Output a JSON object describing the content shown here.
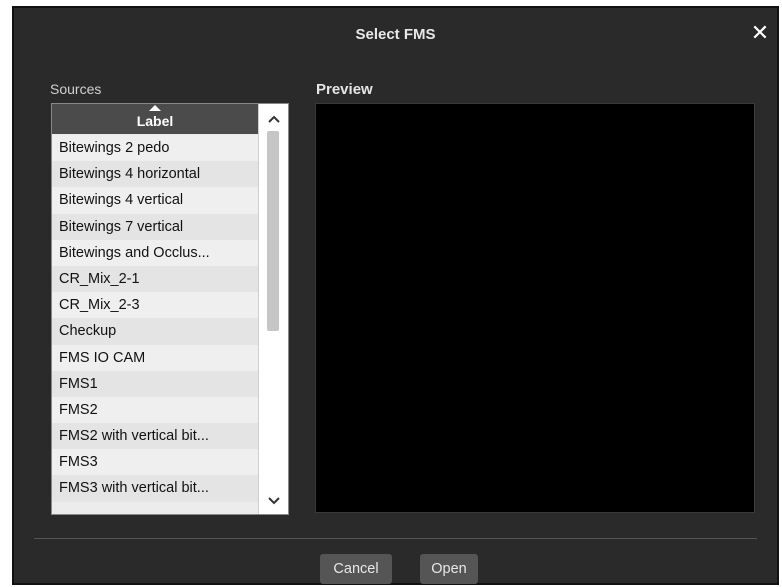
{
  "dialog": {
    "title": "Select FMS",
    "close_glyph": "✕"
  },
  "sources": {
    "label": "Sources",
    "column_header": "Label",
    "items": [
      "Bitewings 2 pedo",
      "Bitewings 4 horizontal",
      "Bitewings 4 vertical",
      "Bitewings 7 vertical",
      "Bitewings and Occlus...",
      "CR_Mix_2-1",
      "CR_Mix_2-3",
      "Checkup",
      "FMS IO CAM",
      "FMS1",
      "FMS2",
      "FMS2 with vertical bit...",
      "FMS3",
      "FMS3 with vertical bit..."
    ]
  },
  "preview": {
    "label": "Preview"
  },
  "buttons": {
    "cancel": "Cancel",
    "open": "Open"
  },
  "icons": {
    "sort": "sort-ascending-icon",
    "scroll_up": "chevron-up-icon",
    "scroll_down": "chevron-down-icon",
    "close": "close-icon"
  },
  "colors": {
    "dialog_bg": "#2a2a2a",
    "header_bg": "#4b4b4b",
    "preview_bg": "#000000",
    "button_bg": "#555555"
  }
}
